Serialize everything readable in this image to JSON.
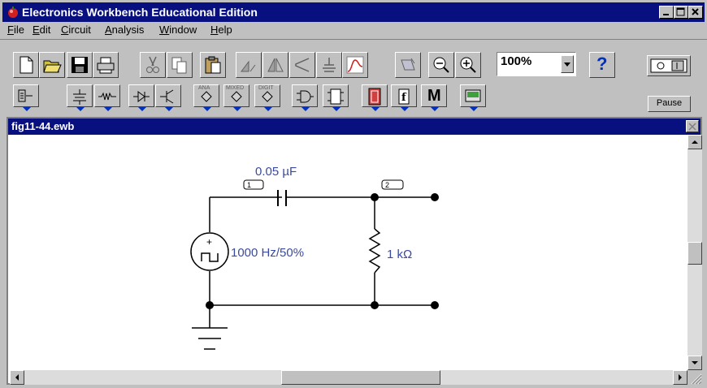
{
  "window": {
    "title": "Electronics Workbench Educational Edition"
  },
  "menu": [
    {
      "label": "File",
      "u": "F",
      "rest": "ile"
    },
    {
      "label": "Edit",
      "u": "E",
      "rest": "dit"
    },
    {
      "label": "Circuit",
      "u": "C",
      "rest": "ircuit"
    },
    {
      "label": "Analysis",
      "u": "A",
      "rest": "nalysis"
    },
    {
      "label": "Window",
      "u": "W",
      "rest": "indow"
    },
    {
      "label": "Help",
      "u": "H",
      "rest": "elp"
    }
  ],
  "toolbar": {
    "zoom_value": "100%",
    "help_label": "?",
    "pause_label": "Pause"
  },
  "parts_bin": {
    "analog_label": "ANA",
    "mixed_label": "MIXED",
    "digital_label": "DIGIT",
    "misc_label": "M"
  },
  "document": {
    "title": "fig11-44.ewb"
  },
  "circuit": {
    "capacitor_label": "0.05 µF",
    "node1_label": "1",
    "node2_label": "2",
    "source_label": "1000 Hz/50%",
    "resistor_label": "1 kΩ"
  },
  "colors": {
    "titlebar": "#08107f",
    "label": "#3a4aa0",
    "face": "#c0c0c0"
  }
}
